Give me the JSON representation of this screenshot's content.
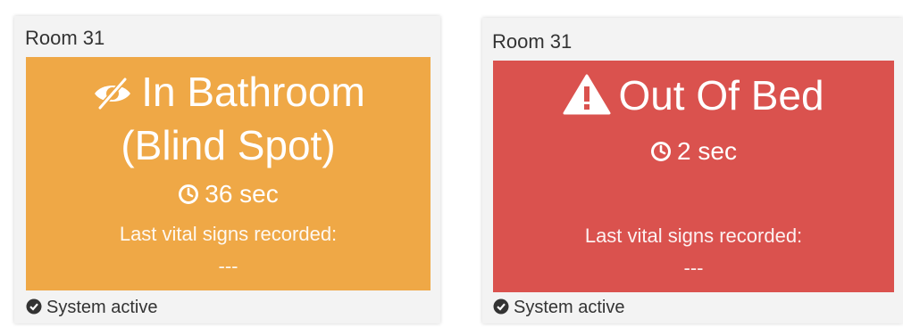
{
  "cards": [
    {
      "room": "Room 31",
      "status_line1": "In Bathroom",
      "status_line2": "(Blind Spot)",
      "status_icon": "eye-slash-icon",
      "color": "#efa846",
      "timer": "36 sec",
      "vitals_label": "Last vital signs recorded:",
      "vitals_value": "---",
      "system_status": "System active"
    },
    {
      "room": "Room 31",
      "status_line1": "Out Of Bed",
      "status_icon": "warning-icon",
      "color": "#da524e",
      "timer": "2 sec",
      "vitals_label": "Last vital signs recorded:",
      "vitals_value": "---",
      "system_status": "System active"
    }
  ]
}
